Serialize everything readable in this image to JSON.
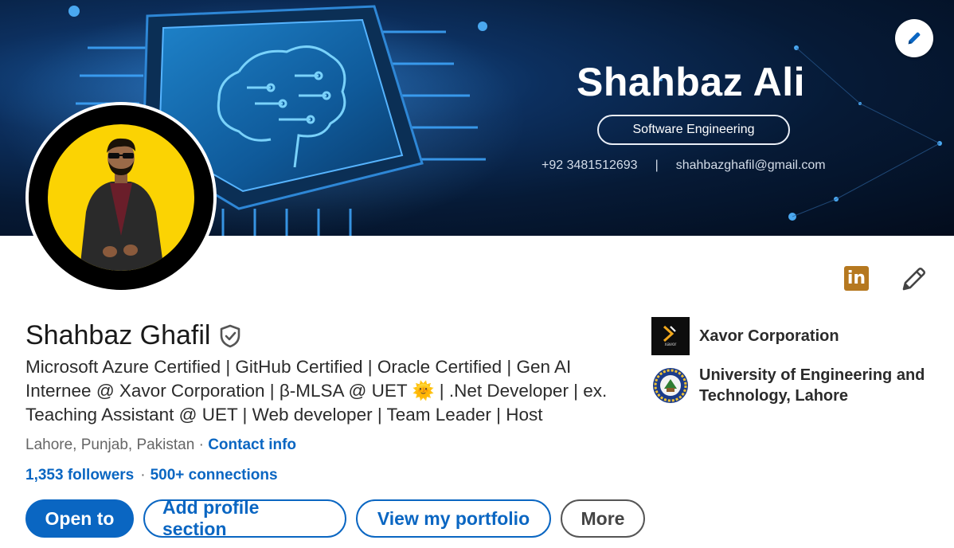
{
  "banner": {
    "name": "Shahbaz Ali",
    "role": "Software Engineering",
    "phone": "+92 3481512693",
    "separator": "|",
    "email": "shahbazghafil@gmail.com"
  },
  "profile": {
    "name": "Shahbaz Ghafil",
    "headline_part1": "Microsoft Azure Certified | GitHub Certified | Oracle Certified | Gen AI Internee @ Xavor Corporation | β-MLSA @ UET ",
    "headline_sun": "🌞",
    "headline_part2": " | .Net Developer | ex. Teaching Assistant @ UET | Web developer | Team Leader | Host",
    "location": "Lahore, Punjab, Pakistan",
    "location_sep": " · ",
    "contact_info": "Contact info",
    "followers": "1,353 followers",
    "network_sep": "·",
    "connections": "500+ connections"
  },
  "buttons": {
    "open_to": "Open to",
    "add_section": "Add profile section",
    "portfolio": "View my portfolio",
    "more": "More"
  },
  "organizations": {
    "experience": "Xavor Corporation",
    "education": "University of Engineering and Technology, Lahore",
    "xavor_logo_text": "xavor"
  },
  "icons": {
    "linkedin": "in"
  },
  "colors": {
    "accent": "#0a66c2",
    "avatar_bg": "#fbd303",
    "linkedin_badge": "#b5781f"
  }
}
